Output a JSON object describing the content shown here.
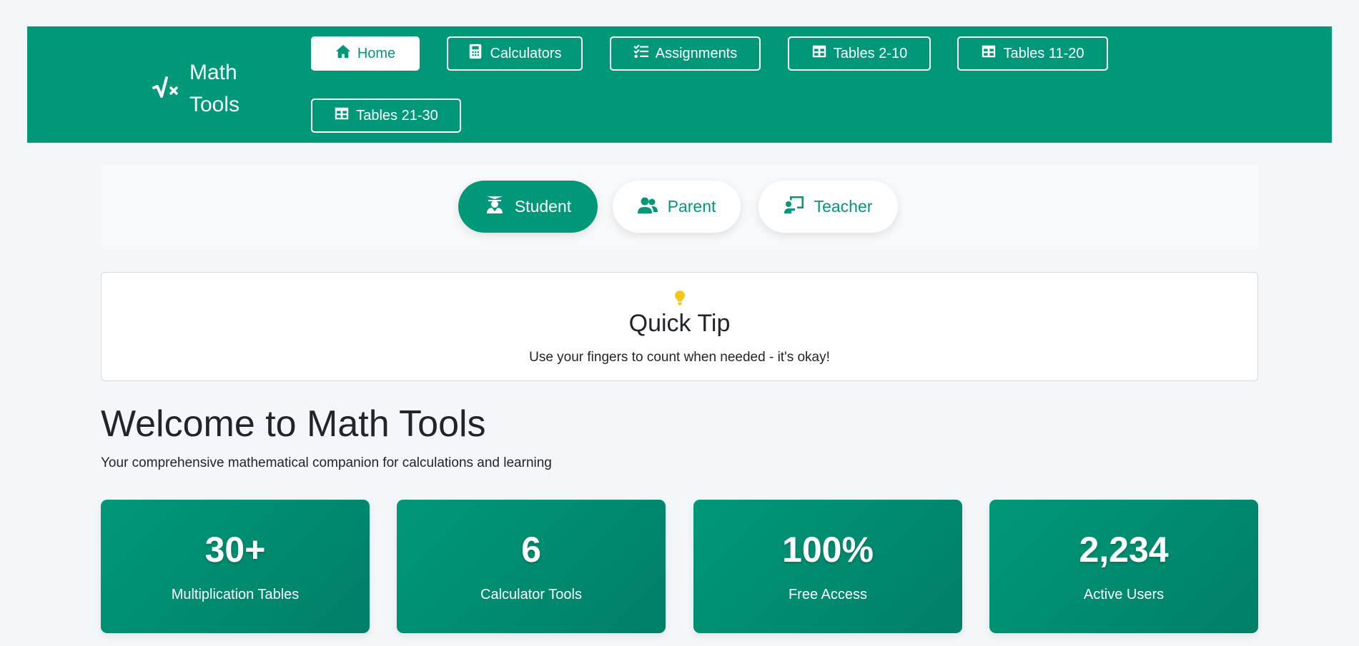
{
  "brand": {
    "line1": "Math",
    "line2": "Tools",
    "icon": "square-root-icon"
  },
  "nav": {
    "items": [
      {
        "label": "Home",
        "icon": "home-icon",
        "active": true
      },
      {
        "label": "Calculators",
        "icon": "calculator-icon",
        "active": false
      },
      {
        "label": "Assignments",
        "icon": "tasks-icon",
        "active": false
      },
      {
        "label": "Tables 2-10",
        "icon": "table-icon",
        "active": false
      },
      {
        "label": "Tables 11-20",
        "icon": "table-icon",
        "active": false
      },
      {
        "label": "Tables 21-30",
        "icon": "table-icon",
        "active": false
      }
    ]
  },
  "roles": {
    "items": [
      {
        "label": "Student",
        "icon": "graduate-icon",
        "active": true
      },
      {
        "label": "Parent",
        "icon": "users-icon",
        "active": false
      },
      {
        "label": "Teacher",
        "icon": "chalkboard-teacher-icon",
        "active": false
      }
    ]
  },
  "tip": {
    "icon": "lightbulb-icon",
    "title": "Quick Tip",
    "text": "Use your fingers to count when needed - it's okay!"
  },
  "welcome": {
    "title": "Welcome to Math Tools",
    "subtitle": "Your comprehensive mathematical companion for calculations and learning"
  },
  "stats": [
    {
      "value": "30+",
      "label": "Multiplication Tables"
    },
    {
      "value": "6",
      "label": "Calculator Tools"
    },
    {
      "value": "100%",
      "label": "Free Access"
    },
    {
      "value": "2,234",
      "label": "Active Users"
    }
  ],
  "colors": {
    "primary": "#009879",
    "primary_dark": "#007f66",
    "background": "#f4f7fa",
    "tip_icon": "#f5c518"
  }
}
